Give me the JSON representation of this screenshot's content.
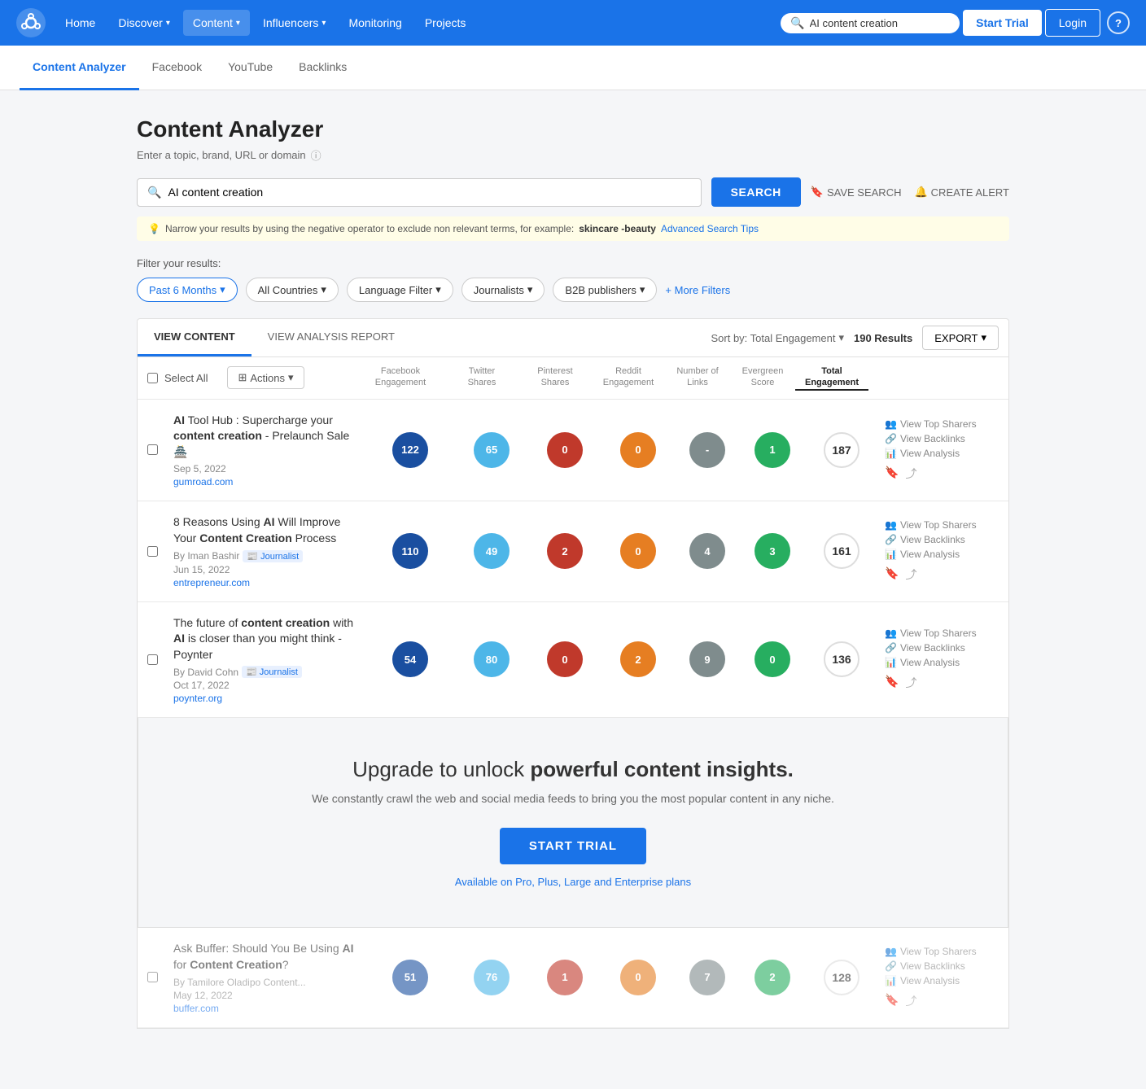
{
  "nav": {
    "links": [
      "Home",
      "Discover",
      "Content",
      "Influencers",
      "Monitoring",
      "Projects"
    ],
    "active": "Content",
    "search_placeholder": "AI content creation",
    "search_value": "AI content creation",
    "btn_trial": "Start Trial",
    "btn_login": "Login",
    "help": "?"
  },
  "tabs": {
    "items": [
      "Content Analyzer",
      "Facebook",
      "YouTube",
      "Backlinks"
    ],
    "active": "Content Analyzer"
  },
  "page": {
    "title": "Content Analyzer",
    "subtitle": "Enter a topic, brand, URL or domain"
  },
  "search": {
    "value": "AI content creation",
    "placeholder": "AI content creation",
    "btn_label": "SEARCH",
    "save_label": "SAVE SEARCH",
    "alert_label": "CREATE ALERT"
  },
  "tip": {
    "text": "Narrow your results by using the negative operator to exclude non relevant terms, for example:",
    "example": "skincare -beauty",
    "link": "Advanced Search Tips"
  },
  "filters": {
    "label": "Filter your results:",
    "items": [
      "Past 6 Months",
      "All Countries",
      "Language Filter",
      "Journalists",
      "B2B publishers"
    ],
    "more": "+ More Filters"
  },
  "results": {
    "view_content": "VIEW CONTENT",
    "view_analysis": "VIEW ANALYSIS REPORT",
    "sort_label": "Sort by: Total Engagement",
    "count": "190 Results",
    "export": "EXPORT",
    "columns": [
      "Facebook\nEngagement",
      "Twitter\nShares",
      "Pinterest\nShares",
      "Reddit\nEngagement",
      "Number of\nLinks",
      "Evergreen\nScore",
      "Total\nEngagement"
    ],
    "active_col": "Total\nEngagement"
  },
  "content_rows": [
    {
      "title": "AI Tool Hub : Supercharge your content creation - Prelaunch Sale 🏯",
      "title_bold": [
        "content creation"
      ],
      "date": "Sep 5, 2022",
      "domain": "gumroad.com",
      "author": null,
      "journalist": false,
      "metrics": [
        122,
        65,
        0,
        0,
        "-",
        1,
        187
      ],
      "metric_colors": [
        "circle-blue",
        "circle-lightblue",
        "circle-red",
        "circle-orange",
        "circle-gray",
        "circle-teal",
        "circle-white"
      ]
    },
    {
      "title": "8 Reasons Using AI Will Improve Your Content Creation Process",
      "title_bold": [
        "AI",
        "Content Creation"
      ],
      "date": "Jun 15, 2022",
      "domain": "entrepreneur.com",
      "author": "By Iman Bashir",
      "journalist": true,
      "metrics": [
        110,
        49,
        2,
        0,
        4,
        3,
        161
      ],
      "metric_colors": [
        "circle-blue",
        "circle-lightblue",
        "circle-red",
        "circle-orange",
        "circle-gray",
        "circle-teal",
        "circle-white"
      ]
    },
    {
      "title": "The future of content creation with AI is closer than you might think - Poynter",
      "title_bold": [
        "content creation",
        "AI"
      ],
      "date": "Oct 17, 2022",
      "domain": "poynter.org",
      "author": "By David Cohn",
      "journalist": true,
      "metrics": [
        54,
        80,
        0,
        2,
        9,
        0,
        136
      ],
      "metric_colors": [
        "circle-blue",
        "circle-lightblue",
        "circle-red",
        "circle-orange",
        "circle-gray",
        "circle-teal",
        "circle-white"
      ]
    }
  ],
  "upgrade": {
    "title_pre": "Upgrade to unlock",
    "title_bold": "powerful content insights.",
    "desc": "We constantly crawl the web and social media feeds to bring you the most popular content in any niche.",
    "btn": "START TRIAL",
    "plans": "Available on Pro, Plus, Large and Enterprise plans"
  },
  "bottom_row": {
    "title": "Ask Buffer: Should You Be Using AI for Content Creation?",
    "date": "May 12, 2022",
    "domain": "buffer.com",
    "author": "By  Tamilore Oladipo Content...",
    "journalist": false,
    "metrics": [
      51,
      76,
      1,
      0,
      7,
      2,
      128
    ],
    "metric_colors": [
      "circle-blue",
      "circle-lightblue",
      "circle-red",
      "circle-orange",
      "circle-gray",
      "circle-teal",
      "circle-white"
    ]
  },
  "row_actions": {
    "top_sharers": "View Top Sharers",
    "backlinks": "View Backlinks",
    "analysis": "View Analysis"
  },
  "colors": {
    "accent": "#1a73e8"
  }
}
